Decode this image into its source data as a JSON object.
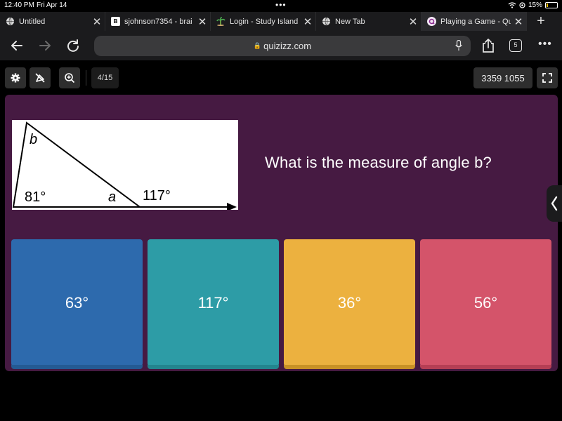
{
  "status": {
    "time": "12:40 PM",
    "date": "Fri Apr 14",
    "battery": "15%",
    "battery_level": 0.15
  },
  "tabs": [
    {
      "label": "Untitled",
      "favicon": "globe-icon",
      "active": false
    },
    {
      "label": "sjohnson7354 - brai",
      "favicon": "brainly-icon",
      "active": false
    },
    {
      "label": "Login - Study Island",
      "favicon": "study-island-icon",
      "active": false
    },
    {
      "label": "New Tab",
      "favicon": "globe-icon",
      "active": false
    },
    {
      "label": "Playing a Game - Qu",
      "favicon": "quizizz-icon",
      "active": true
    }
  ],
  "address": {
    "url": "quizizz.com",
    "tab_count": "5"
  },
  "quiz": {
    "progress": "4/15",
    "game_code": "3359 1055",
    "question": "What is the measure of angle b?",
    "figure": {
      "label_b": "b",
      "label_a": "a",
      "angle_left": "81°",
      "angle_exterior": "117°"
    },
    "options": [
      {
        "label": "63°",
        "color": "#2d6aad",
        "shade": "#245a93"
      },
      {
        "label": "117°",
        "color": "#2d9ca6",
        "shade": "#23858e"
      },
      {
        "label": "36°",
        "color": "#ecb13f",
        "shade": "#c99126"
      },
      {
        "label": "56°",
        "color": "#d4546a",
        "shade": "#b53f55"
      }
    ]
  },
  "colors": {
    "card_bg": "#461a42",
    "chrome_bg": "#1b1b1d"
  }
}
